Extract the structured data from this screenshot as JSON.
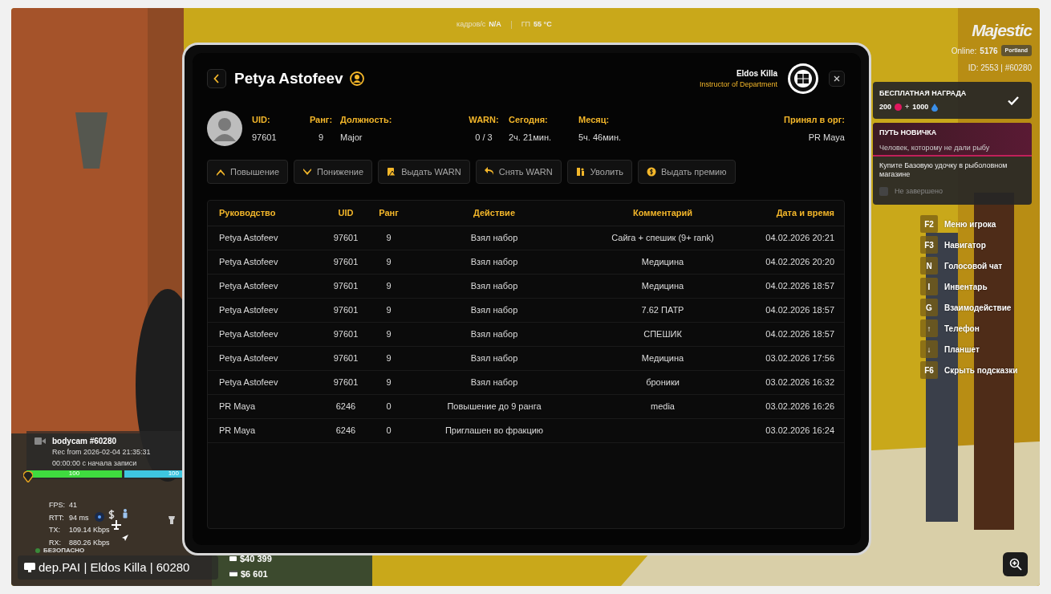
{
  "top_stats": {
    "fps_label": "кадров/с",
    "fps_value": "N/A",
    "gpu_label": "ГП",
    "gpu_value": "55 °C"
  },
  "server_info": {
    "brand": "Majestic",
    "online_label": "Online:",
    "online": "5176",
    "server": "Portland",
    "id_line": "ID: 2553 | #60280"
  },
  "reward": {
    "title": "БЕСПЛАТНАЯ НАГРАДА",
    "amount_1": "200",
    "plus": "+",
    "amount_2": "1000",
    "claimed": true
  },
  "quest": {
    "title": "ПУТЬ НОВИЧКА",
    "subtitle": "Человек, которому не дали рыбу",
    "task": "Купите Базовую удочку в рыболовном магазине",
    "status": "Не завершено",
    "done": false
  },
  "hotkeys": [
    {
      "key": "F2",
      "label": "Меню игрока"
    },
    {
      "key": "F3",
      "label": "Навигатор"
    },
    {
      "key": "N",
      "label": "Голосовой чат"
    },
    {
      "key": "I",
      "label": "Инвентарь"
    },
    {
      "key": "G",
      "label": "Взаимодействие"
    },
    {
      "key": "↑",
      "label": "Телефон"
    },
    {
      "key": "↓",
      "label": "Планшет"
    },
    {
      "key": "F6",
      "label": "Скрыть подсказки"
    }
  ],
  "bodycam": {
    "title": "bodycam #60280",
    "rec": "Rec from 2026-02-04 21:35:31",
    "elapsed": "00:00:00 с начала записи",
    "health": {
      "value": "100",
      "level": 1
    },
    "armor": {
      "value": "100",
      "level": 1
    }
  },
  "net_stats": [
    {
      "label": "FPS:",
      "value": "41"
    },
    {
      "label": "RTT:",
      "value": "94 ms"
    },
    {
      "label": "TX:",
      "value": "109.14 Kbps"
    },
    {
      "label": "RX:",
      "value": "880.26 Kbps"
    }
  ],
  "zone": "БЕЗОПАСНО",
  "money": [
    "$40 399",
    "$6 601"
  ],
  "footer": "dep.PAI | Eldos Killa | 60280",
  "tablet": {
    "title": "Petya Astofeev",
    "viewer": {
      "name": "Eldos Killa",
      "role": "Instructor of Department"
    },
    "stats": [
      {
        "label": "UID:",
        "value": "97601"
      },
      {
        "label": "Ранг:",
        "value": "9"
      },
      {
        "label": "Должность:",
        "value": "Major"
      },
      {
        "label": "WARN:",
        "value": "0 / 3"
      },
      {
        "label": "Сегодня:",
        "value": "2ч. 21мин."
      },
      {
        "label": "Месяц:",
        "value": "5ч. 46мин."
      },
      {
        "label": "Принял в орг:",
        "value": "PR Maya"
      }
    ],
    "actions": [
      {
        "kind": "promote",
        "label": "Повышение"
      },
      {
        "kind": "demote",
        "label": "Понижение"
      },
      {
        "kind": "warn",
        "label": "Выдать WARN"
      },
      {
        "kind": "unwarn",
        "label": "Снять WARN"
      },
      {
        "kind": "fire",
        "label": "Уволить"
      },
      {
        "kind": "bonus",
        "label": "Выдать премию"
      }
    ],
    "table": {
      "columns": [
        "Руководство",
        "UID",
        "Ранг",
        "Действие",
        "Комментарий",
        "Дата и время"
      ],
      "rows": [
        [
          "Petya Astofeev",
          "97601",
          "9",
          "Взял набор",
          "Сайга + спешик (9+ rank)",
          "04.02.2026 20:21"
        ],
        [
          "Petya Astofeev",
          "97601",
          "9",
          "Взял набор",
          "Медицина",
          "04.02.2026 20:20"
        ],
        [
          "Petya Astofeev",
          "97601",
          "9",
          "Взял набор",
          "Медицина",
          "04.02.2026 18:57"
        ],
        [
          "Petya Astofeev",
          "97601",
          "9",
          "Взял набор",
          "7.62 ПАТР",
          "04.02.2026 18:57"
        ],
        [
          "Petya Astofeev",
          "97601",
          "9",
          "Взял набор",
          "СПЕШИК",
          "04.02.2026 18:57"
        ],
        [
          "Petya Astofeev",
          "97601",
          "9",
          "Взял набор",
          "Медицина",
          "03.02.2026 17:56"
        ],
        [
          "Petya Astofeev",
          "97601",
          "9",
          "Взял набор",
          "броники",
          "03.02.2026 16:32"
        ],
        [
          "PR Maya",
          "6246",
          "0",
          "Повышение до 9 ранга",
          "media",
          "03.02.2026 16:26"
        ],
        [
          "PR Maya",
          "6246",
          "0",
          "Приглашен во фракцию",
          "",
          "03.02.2026 16:24"
        ]
      ]
    }
  }
}
